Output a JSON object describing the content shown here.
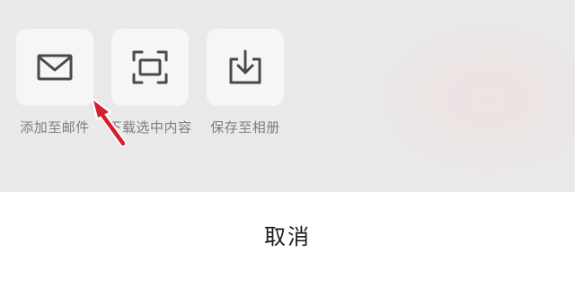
{
  "actions": [
    {
      "label": "添加至邮件",
      "icon": "mail-icon"
    },
    {
      "label": "下载选中内容",
      "icon": "scan-frame-icon"
    },
    {
      "label": "保存至相册",
      "icon": "download-tray-icon"
    }
  ],
  "cancel_label": "取消",
  "annotation": {
    "icon": "red-arrow-pointer",
    "color": "#d3202a"
  },
  "colors": {
    "panel_background": "#e9e9e9",
    "tile_background": "#f6f6f6",
    "icon_stroke": "#4a4a4a",
    "label_text": "#7d7d7d"
  }
}
